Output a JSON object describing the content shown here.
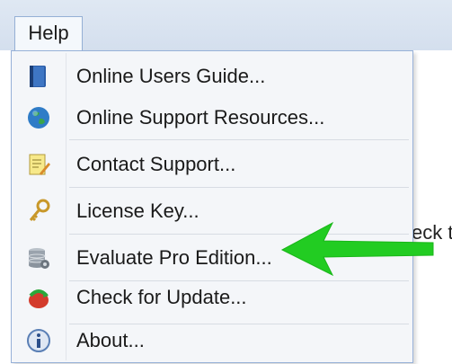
{
  "menubar": {
    "help_label": "Help"
  },
  "dropdown": {
    "items": [
      {
        "label": "Online Users Guide...",
        "icon": "book-icon"
      },
      {
        "label": "Online Support Resources...",
        "icon": "globe-icon"
      },
      {
        "label": "Contact Support...",
        "icon": "note-pencil-icon"
      },
      {
        "label": "License Key...",
        "icon": "key-icon"
      },
      {
        "label": "Evaluate Pro Edition...",
        "icon": "database-icon"
      },
      {
        "label": "Check for Update...",
        "icon": "update-icon"
      },
      {
        "label": "About...",
        "icon": "info-icon"
      }
    ]
  },
  "background": {
    "right_text": "eck t"
  },
  "colors": {
    "accent_border": "#97b1d8",
    "arrow_green": "#22cc22"
  }
}
